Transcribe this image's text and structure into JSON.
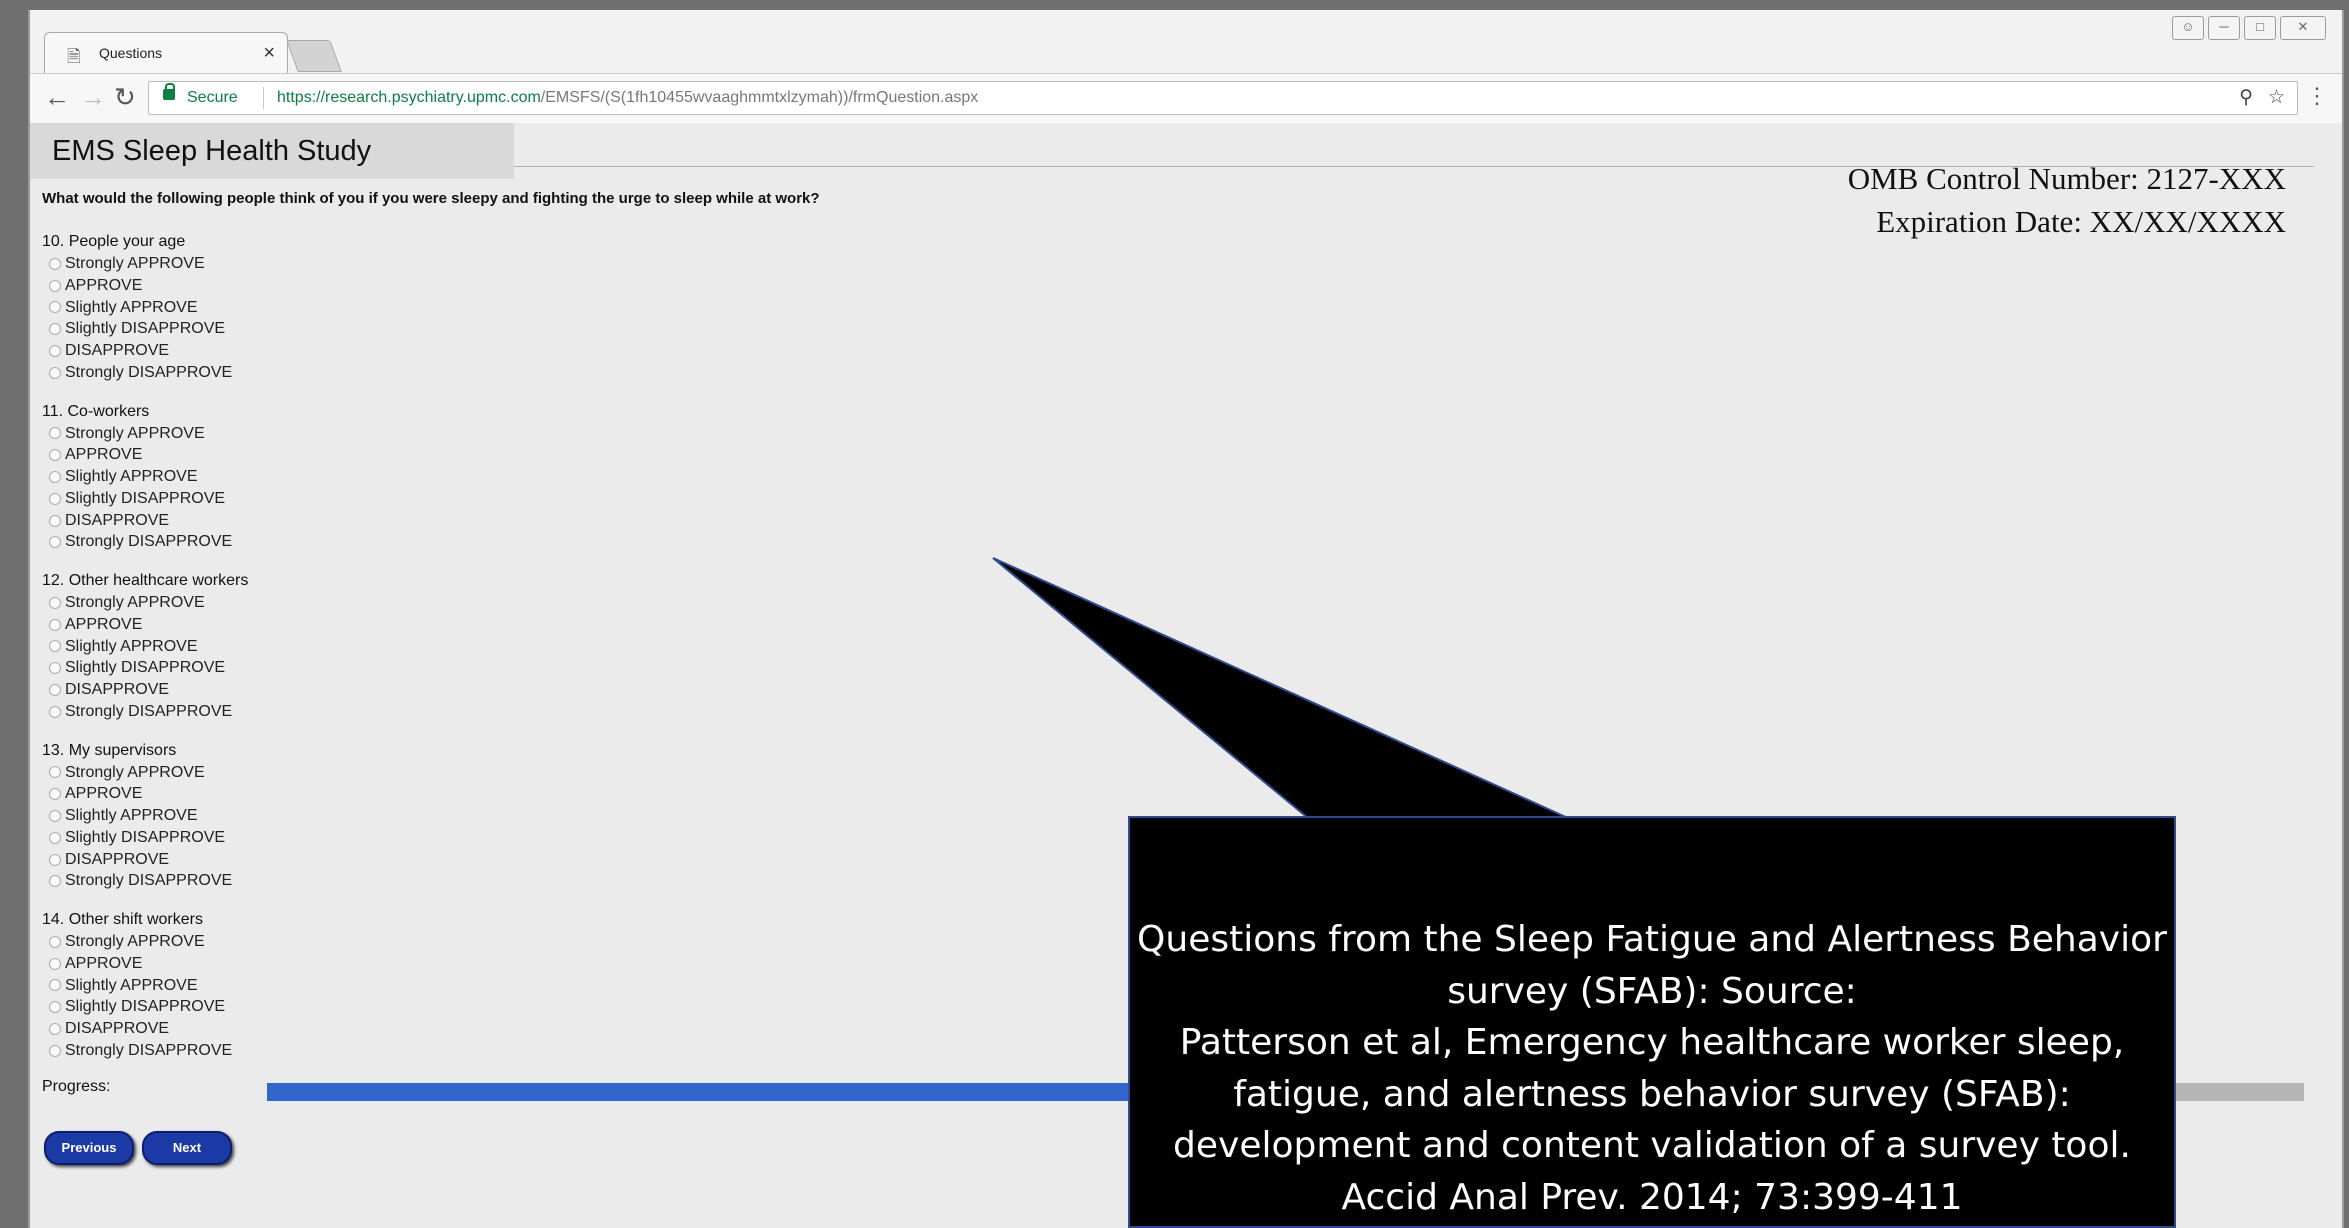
{
  "browser": {
    "tab_title": "Questions",
    "tab_close": "×",
    "secure_label": "Secure",
    "url_prefix": "https://research.psychiatry.upmc.com",
    "url_rest": "/EMSFS/(S(1fh10455wvaaghmmtxlzymah))/frmQuestion.aspx"
  },
  "page": {
    "header_title": "EMS Sleep Health Study",
    "omb_control": "OMB Control Number: 2127-XXX",
    "expiration": "Expiration Date:  XX/XX/XXXX",
    "question": "What would the following people think of you if you were sleepy and fighting the urge to sleep while at work?",
    "items": [
      {
        "label": "10. People your age",
        "options": [
          "Strongly APPROVE",
          "APPROVE",
          "Slightly APPROVE",
          "Slightly DISAPPROVE",
          "DISAPPROVE",
          "Strongly DISAPPROVE"
        ]
      },
      {
        "label": "11. Co-workers",
        "options": [
          "Strongly APPROVE",
          "APPROVE",
          "Slightly APPROVE",
          "Slightly DISAPPROVE",
          "DISAPPROVE",
          "Strongly DISAPPROVE"
        ]
      },
      {
        "label": "12. Other healthcare workers",
        "options": [
          "Strongly APPROVE",
          "APPROVE",
          "Slightly APPROVE",
          "Slightly DISAPPROVE",
          "DISAPPROVE",
          "Strongly DISAPPROVE"
        ]
      },
      {
        "label": "13. My supervisors",
        "options": [
          "Strongly APPROVE",
          "APPROVE",
          "Slightly APPROVE",
          "Slightly DISAPPROVE",
          "DISAPPROVE",
          "Strongly DISAPPROVE"
        ]
      },
      {
        "label": "14. Other shift workers",
        "options": [
          "Strongly APPROVE",
          "APPROVE",
          "Slightly APPROVE",
          "Slightly DISAPPROVE",
          "DISAPPROVE",
          "Strongly DISAPPROVE"
        ]
      }
    ],
    "progress_label": "Progress:",
    "progress_fraction": 0.62,
    "previous_label": "Previous",
    "next_label": "Next"
  },
  "callout": {
    "lines": [
      "Questions from the Sleep Fatigue and Alertness Behavior",
      "survey (SFAB): Source:",
      "Patterson et al, Emergency healthcare worker sleep,",
      "fatigue, and alertness behavior survey (SFAB):",
      "development and content validation of a survey tool.",
      "Accid Anal Prev. 2014; 73:399-411"
    ]
  },
  "colors": {
    "progress_fill": "#3366cc",
    "progress_track": "#b5b5b5",
    "secure_green": "#0b8043",
    "button_blue": "#1c3aa6"
  },
  "icons": [
    "page-icon",
    "back-icon",
    "forward-icon",
    "reload-icon",
    "lock-icon",
    "zoom-icon",
    "star-icon",
    "menu-icon"
  ]
}
